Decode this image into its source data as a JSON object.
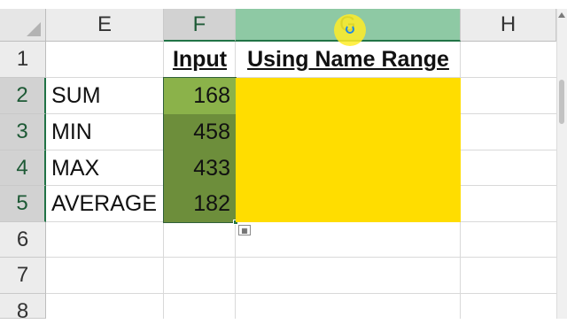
{
  "columns": [
    "E",
    "F",
    "G",
    "H"
  ],
  "rows": [
    "1",
    "2",
    "3",
    "4",
    "5",
    "6",
    "7",
    "8"
  ],
  "headers": {
    "input": "Input",
    "using": "Using Name Range"
  },
  "labels": [
    "SUM",
    "MIN",
    "MAX",
    "AVERAGE"
  ],
  "inputs": [
    "168",
    "458",
    "433",
    "182"
  ],
  "colors": {
    "input_fill": "#6d8e3b",
    "active_input_fill": "#8bb24a",
    "result_fill": "#ffdd00",
    "selection_accent": "#217346"
  },
  "icons": {
    "quick_analysis": "quick-analysis-icon",
    "cursor": "mouse-cursor-icon"
  }
}
